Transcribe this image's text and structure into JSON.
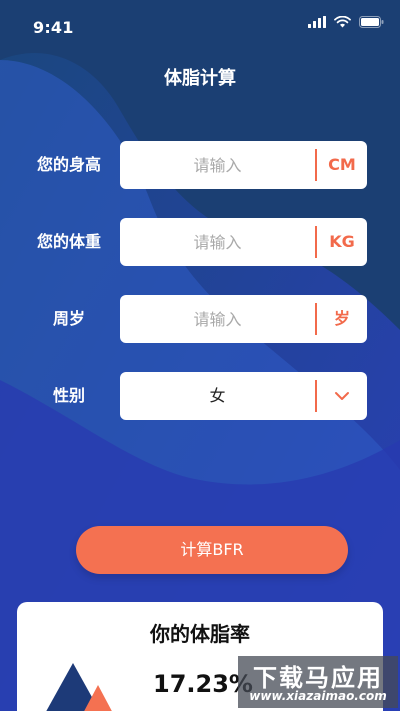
{
  "status_bar": {
    "time": "9:41"
  },
  "page": {
    "title": "体脂计算"
  },
  "form": {
    "height": {
      "label": "您的身高",
      "placeholder": "请输入",
      "unit": "CM"
    },
    "weight": {
      "label": "您的体重",
      "placeholder": "请输入",
      "unit": "KG"
    },
    "age": {
      "label": "周岁",
      "placeholder": "请输入",
      "unit": "岁"
    },
    "gender": {
      "label": "性别",
      "value": "女"
    }
  },
  "calculate_button": {
    "label": "计算BFR"
  },
  "result": {
    "title": "你的体脂率",
    "value": "17.23%"
  },
  "watermark": {
    "brand": "下载马应用",
    "site": "www.xiazaimao.com"
  },
  "colors": {
    "accent": "#f47151",
    "background": "#1e3f8c",
    "card": "#ffffff"
  }
}
